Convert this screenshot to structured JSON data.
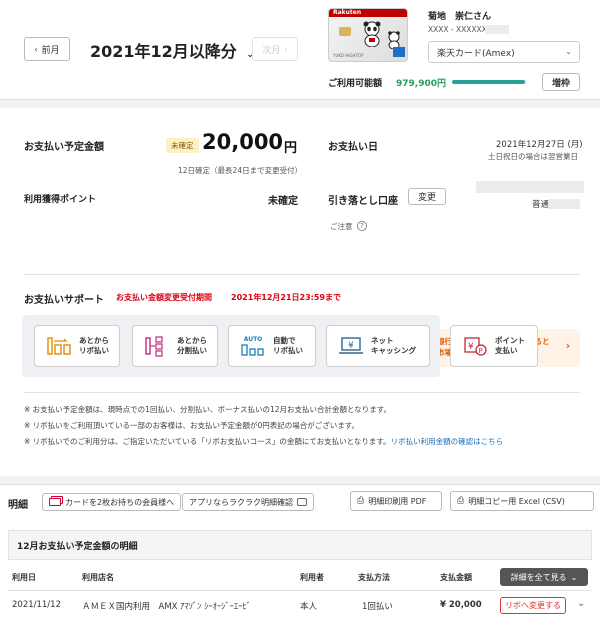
{
  "header": {
    "prev_label": "前月",
    "month_title": "2021年12月以降分",
    "next_label": "次月",
    "card_name_text": "Rakuten",
    "card_holder_text": "YUKO HIGHTOP",
    "user_name": "菊地　崇仁さん",
    "card_number_mask": "XXXX - XXXXXX - ",
    "card_select_value": "楽天カード(Amex)",
    "available_label": "ご利用可能額",
    "available_amount": "979,900円",
    "available_fraction": 0.98,
    "increase_label": "増枠"
  },
  "payment": {
    "title": "お支払い予定金額",
    "status_badge": "未確定",
    "amount": "20,000",
    "currency": "円",
    "note": "12日確定（最長24日まで変更受付）",
    "points_label": "利用獲得ポイント",
    "points_value": "未確定",
    "date_label": "お支払い日",
    "date_value": "2021年12月27日 (月)",
    "date_note": "土日祝日の場合は翌営業日",
    "account_label": "引き落とし口座",
    "change_label": "変更",
    "account_type": "普通",
    "caution_label": "ご注意",
    "promo_line1": "楽天銀行で楽天カードの引落をすると",
    "promo_line2": "楽天市場のお買い物が+1倍"
  },
  "support": {
    "title": "お支払いサポート",
    "period_label": "お支払い金額変更受付期間",
    "period_value": "2021年12月21日23:59まで",
    "buttons": [
      {
        "line1": "あとから",
        "line2": "リボ払い"
      },
      {
        "line1": "あとから",
        "line2": "分割払い"
      },
      {
        "line1": "自動で",
        "line2": "リボ払い",
        "icon_text": "AUTO"
      },
      {
        "line1": "ネット",
        "line2": "キャッシング"
      },
      {
        "line1": "ポイント",
        "line2": "支払い"
      }
    ]
  },
  "notes": {
    "n1": "※ お支払い予定金額は、現時点での1回払い、分割払い、ボーナス払いの12月お支払い合計金額となります。",
    "n2": "※ リボ払いをご利用頂いている一部のお客様は、お支払い予定金額が0円表記の場合がございます。",
    "n3": "※ リボ払いでのご利用分は、ご指定いただいている「リボお支払いコース」の金額にてお支払いとなります。",
    "n3_link": "リボ払い利用金額の確認はこちら"
  },
  "details": {
    "title": "明細",
    "two_cards_label": "カードを2枚お持ちの会員様へ",
    "app_label": "アプリならラクラク明細確認",
    "pdf_label": "明細印刷用 PDF",
    "csv_label": "明細コピー用 Excel (CSV)",
    "section_title": "12月お支払い予定金額の明細",
    "headers": {
      "date": "利用日",
      "store": "利用店名",
      "user": "利用者",
      "method": "支払方法",
      "amount": "支払金額"
    },
    "show_all_label": "詳細を全て見る",
    "row": {
      "date": "2021/11/12",
      "store": "ＡＭＥＸ国内利用　AMX ｱﾏｿﾞﾝ ｼｰｵｰｼﾞｰｴｰﾋﾞ",
      "user": "本人",
      "method": "1回払い",
      "amount": "¥ 20,000",
      "action": "リボへ変更する"
    }
  }
}
